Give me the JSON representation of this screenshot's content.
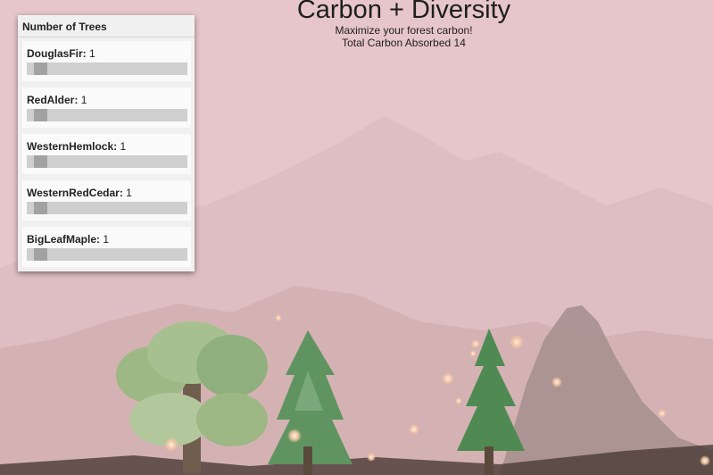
{
  "header": {
    "title": "Carbon + Diversity",
    "subtitle": "Maximize your forest carbon!",
    "total_label": "Total Carbon Absorbed",
    "total_value": "14"
  },
  "panel": {
    "title": "Number of Trees",
    "slider_max": 20,
    "trees": [
      {
        "name": "DouglasFir",
        "count": "1",
        "value": 1
      },
      {
        "name": "RedAlder",
        "count": "1",
        "value": 1
      },
      {
        "name": "WesternHemlock",
        "count": "1",
        "value": 1
      },
      {
        "name": "WesternRedCedar",
        "count": "1",
        "value": 1
      },
      {
        "name": "BigLeafMaple",
        "count": "1",
        "value": 1
      }
    ]
  },
  "colors": {
    "sky": "#e6c6ca",
    "mountain_far": "#dcbcbf",
    "mountain_near": "#a48e8d",
    "ground": "#4a3a36",
    "fir_green": "#4f8a52",
    "maple_green": "#9db885",
    "particle": "#f6c7a4",
    "slider_track": "#cfcfcf",
    "slider_thumb": "#a2a2a2"
  }
}
